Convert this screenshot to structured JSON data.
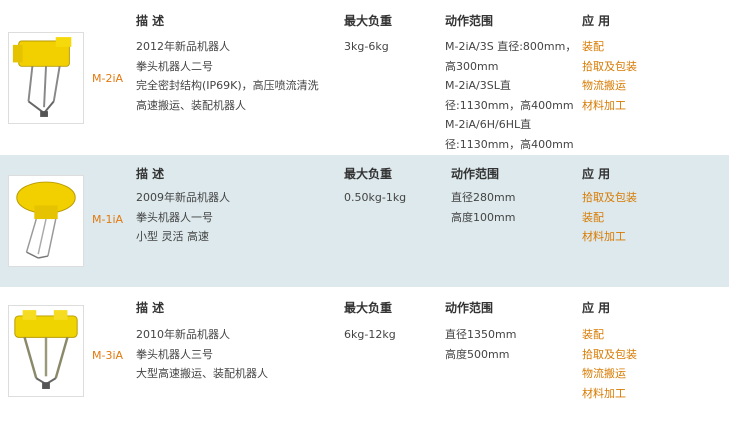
{
  "headers": {
    "desc": "描 述",
    "payload": "最大负重",
    "range": "动作范围",
    "app": "应 用"
  },
  "products": [
    {
      "model": "M-2iA",
      "image_icon": "yellow-parallel-robot-icon",
      "desc": [
        "2012年新品机器人",
        "拳头机器人二号",
        "完全密封结构(IP69K)，高压喷流清洗",
        "高速搬运、装配机器人"
      ],
      "payload": "3kg-6kg",
      "range": [
        "M-2iA/3S 直径:800mm，",
        "高300mm",
        "M-2iA/3SL直",
        "径:1130mm，高400mm",
        "M-2iA/6H/6HL直",
        "径:1130mm，高400mm"
      ],
      "apps": [
        "装配",
        "拾取及包装",
        "物流搬运",
        "材料加工"
      ]
    },
    {
      "model": "M-1iA",
      "image_icon": "yellow-parallel-robot-icon",
      "desc": [
        "2009年新品机器人",
        "拳头机器人一号",
        "小型 灵活 高速"
      ],
      "payload": "0.50kg-1kg",
      "range": [
        "直径280mm",
        "高度100mm"
      ],
      "apps": [
        "拾取及包装",
        "装配",
        "材料加工"
      ]
    },
    {
      "model": "M-3iA",
      "image_icon": "yellow-parallel-robot-icon",
      "desc": [
        "2010年新品机器人",
        "拳头机器人三号",
        "大型高速搬运、装配机器人"
      ],
      "payload": "6kg-12kg",
      "range": [
        "直径1350mm",
        "高度500mm"
      ],
      "apps": [
        "装配",
        "拾取及包装",
        "物流搬运",
        "材料加工"
      ]
    }
  ],
  "colors": {
    "accent": "#d87a00",
    "row_alt": "#dde9ec"
  }
}
